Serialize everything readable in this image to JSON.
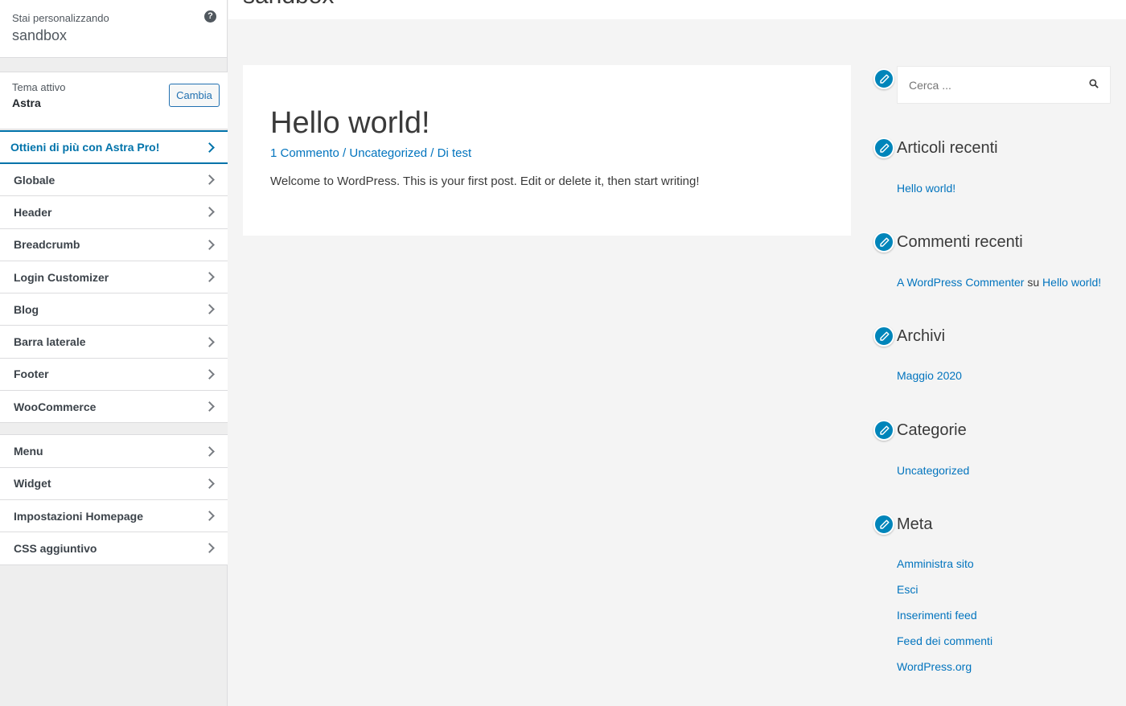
{
  "customizer": {
    "customizing_label": "Stai personalizzando",
    "site_name": "sandbox",
    "help_icon_glyph": "?",
    "active_theme_label": "Tema attivo",
    "active_theme_name": "Astra",
    "change_button": "Cambia",
    "sections_primary": [
      {
        "label": "Ottieni di più con Astra Pro!",
        "highlight": true
      },
      {
        "label": "Globale"
      },
      {
        "label": "Header"
      },
      {
        "label": "Breadcrumb"
      },
      {
        "label": "Login Customizer"
      },
      {
        "label": "Blog"
      },
      {
        "label": "Barra laterale"
      },
      {
        "label": "Footer"
      },
      {
        "label": "WooCommerce"
      }
    ],
    "sections_secondary": [
      {
        "label": "Menu"
      },
      {
        "label": "Widget"
      },
      {
        "label": "Impostazioni Homepage"
      },
      {
        "label": "CSS aggiuntivo"
      }
    ]
  },
  "preview": {
    "site_title": "sandbox",
    "post": {
      "title": "Hello world!",
      "comments": "1 Commento",
      "category": "Uncategorized",
      "author": "Di test",
      "separator": " / ",
      "excerpt": "Welcome to WordPress. This is your first post. Edit or delete it, then start writing!"
    },
    "search": {
      "placeholder": "Cerca ..."
    },
    "widgets": {
      "recent_posts": {
        "title": "Articoli recenti",
        "items": [
          "Hello world!"
        ]
      },
      "recent_comments": {
        "title": "Commenti recenti",
        "author": "A WordPress Commenter",
        "connector": "su",
        "post": "Hello world!"
      },
      "archives": {
        "title": "Archivi",
        "items": [
          "Maggio 2020"
        ]
      },
      "categories": {
        "title": "Categorie",
        "items": [
          "Uncategorized"
        ]
      },
      "meta": {
        "title": "Meta",
        "items": [
          "Amministra sito",
          "Esci",
          "Inserimenti feed",
          "Feed dei commenti",
          "WordPress.org"
        ]
      }
    }
  },
  "colors": {
    "link": "#0274be",
    "accent": "#0073aa",
    "edit_icon": "#0085ba"
  },
  "icons": [
    "help-icon",
    "chevron-right-icon",
    "edit-pencil-icon",
    "search-icon"
  ]
}
